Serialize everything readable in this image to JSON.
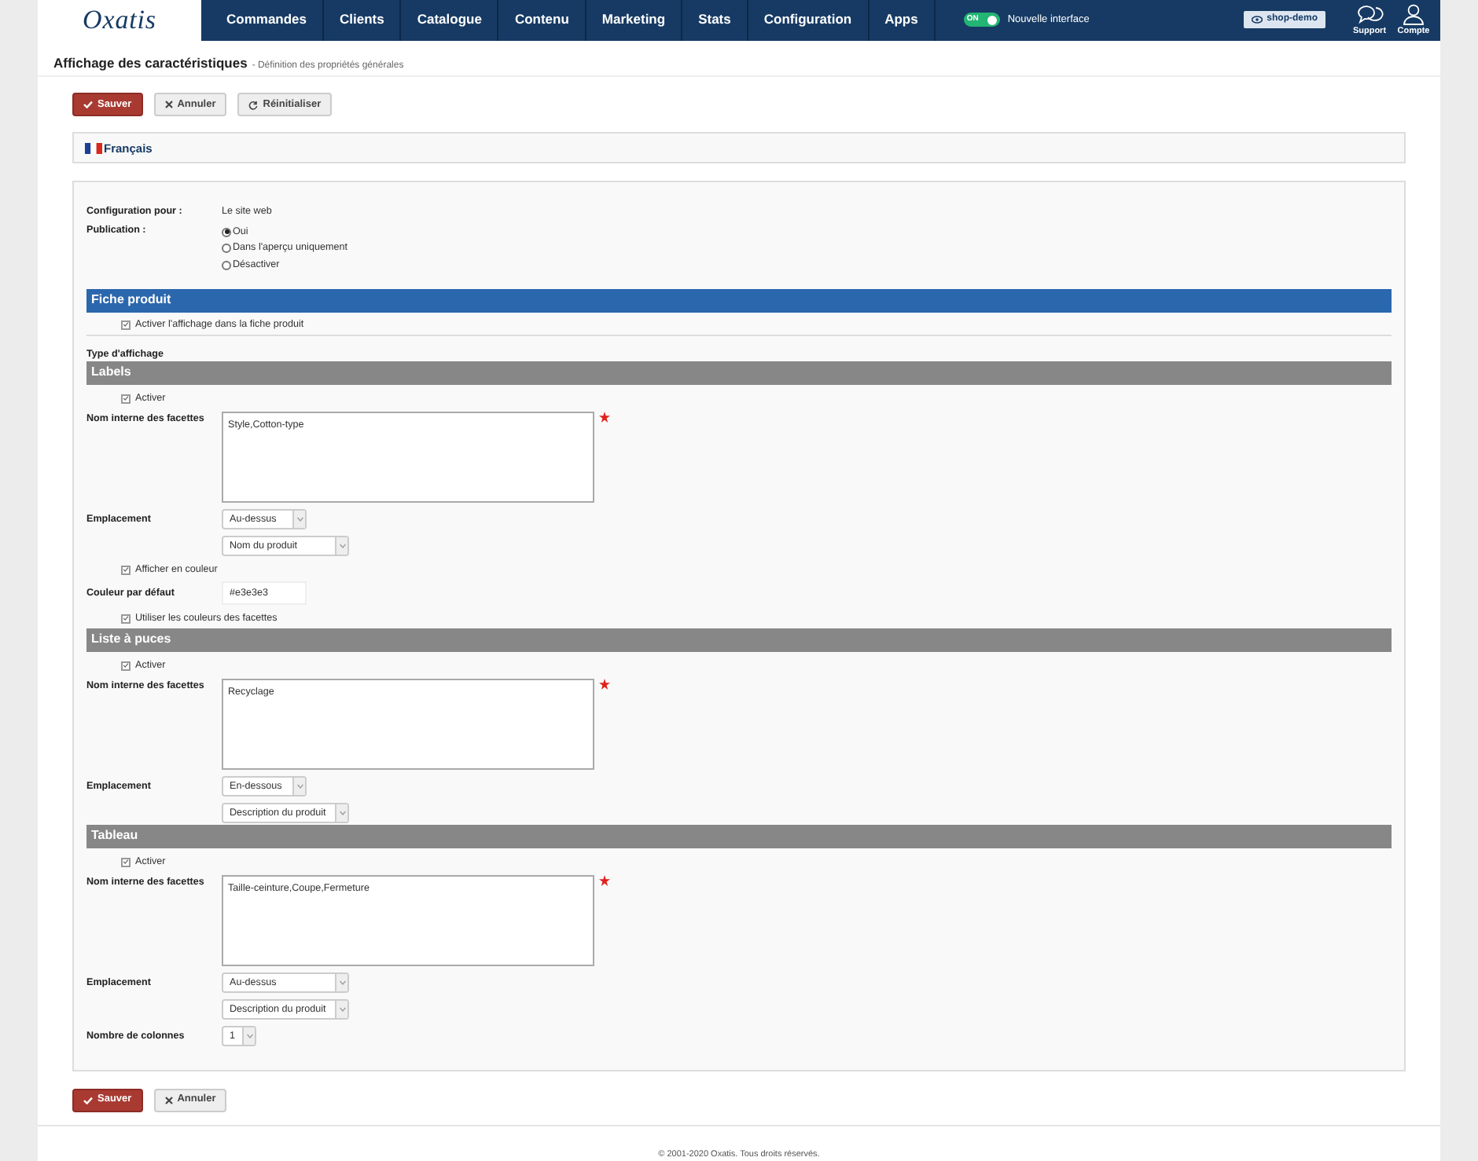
{
  "header": {
    "logo": "Oxatis",
    "nav": [
      {
        "label": "Commandes"
      },
      {
        "label": "Clients"
      },
      {
        "label": "Catalogue"
      },
      {
        "label": "Contenu"
      },
      {
        "label": "Marketing"
      },
      {
        "label": "Stats"
      },
      {
        "label": "Configuration"
      },
      {
        "label": "Apps"
      }
    ],
    "toggle": {
      "label": "ON",
      "on": true
    },
    "toggle_caption": "Nouvelle interface",
    "shop_button": "shop-demo",
    "actions": [
      {
        "kind": "support",
        "label": "Support"
      },
      {
        "kind": "account",
        "label": "Compte"
      }
    ]
  },
  "page": {
    "title": "Affichage des caractéristiques",
    "subtitle": "- Définition des propriétés générales"
  },
  "toolbar": [
    {
      "kind": "save",
      "label": "Sauver"
    },
    {
      "kind": "cancel",
      "label": "Annuler"
    },
    {
      "kind": "reset",
      "label": "Réinitialiser"
    }
  ],
  "language": "Français",
  "config": {
    "label": "Configuration pour :",
    "value": "Le site web"
  },
  "publication": {
    "label": "Publication :",
    "options": [
      {
        "label": "Oui",
        "selected": true
      },
      {
        "label": "Dans l'aperçu uniquement",
        "selected": false
      },
      {
        "label": "Désactiver",
        "selected": false
      }
    ]
  },
  "section": {
    "title": "Fiche produit",
    "checkbox": {
      "label": "Activer l'affichage dans la fiche produit",
      "checked": true
    }
  },
  "display_type_label": "Type d'affichage",
  "blocks": [
    {
      "title": "Labels",
      "rows": [
        {
          "kind": "checkbox",
          "label": "Activer",
          "checked": true
        },
        {
          "kind": "textarea",
          "label": "Nom interne des facettes",
          "value": "Style,Cotton-type",
          "required": true
        },
        {
          "kind": "short_select",
          "label": "Emplacement",
          "value": "Au-dessus"
        },
        {
          "kind": "select",
          "value": "Nom du produit"
        },
        {
          "kind": "checkbox",
          "label": "Afficher en couleur",
          "checked": true
        },
        {
          "kind": "text",
          "label": "Couleur par défaut",
          "value": "#e3e3e3"
        },
        {
          "kind": "checkbox",
          "label": "Utiliser les couleurs des facettes",
          "checked": true
        }
      ]
    },
    {
      "title": "Liste à puces",
      "rows": [
        {
          "kind": "checkbox",
          "label": "Activer",
          "checked": true
        },
        {
          "kind": "textarea",
          "label": "Nom interne des facettes",
          "value": "Recyclage",
          "required": true
        },
        {
          "kind": "short_select",
          "label": "Emplacement",
          "value": "En-dessous"
        },
        {
          "kind": "select",
          "value": "Description du produit"
        }
      ]
    },
    {
      "title": "Tableau",
      "rows": [
        {
          "kind": "checkbox",
          "label": "Activer",
          "checked": true
        },
        {
          "kind": "textarea",
          "label": "Nom interne des facettes",
          "value": "Taille-ceinture,Coupe,Fermeture",
          "required": true
        },
        {
          "kind": "select",
          "label": "Emplacement",
          "value": "Au-dessus"
        },
        {
          "kind": "select",
          "value": "Description du produit"
        },
        {
          "kind": "tiny_select",
          "label": "Nombre de colonnes",
          "value": "1"
        }
      ]
    }
  ],
  "bottom_buttons": [
    {
      "kind": "save",
      "label": "Sauver"
    },
    {
      "kind": "cancel",
      "label": "Annuler"
    }
  ],
  "footer": "© 2001-2020 Oxatis. Tous droits réservés."
}
